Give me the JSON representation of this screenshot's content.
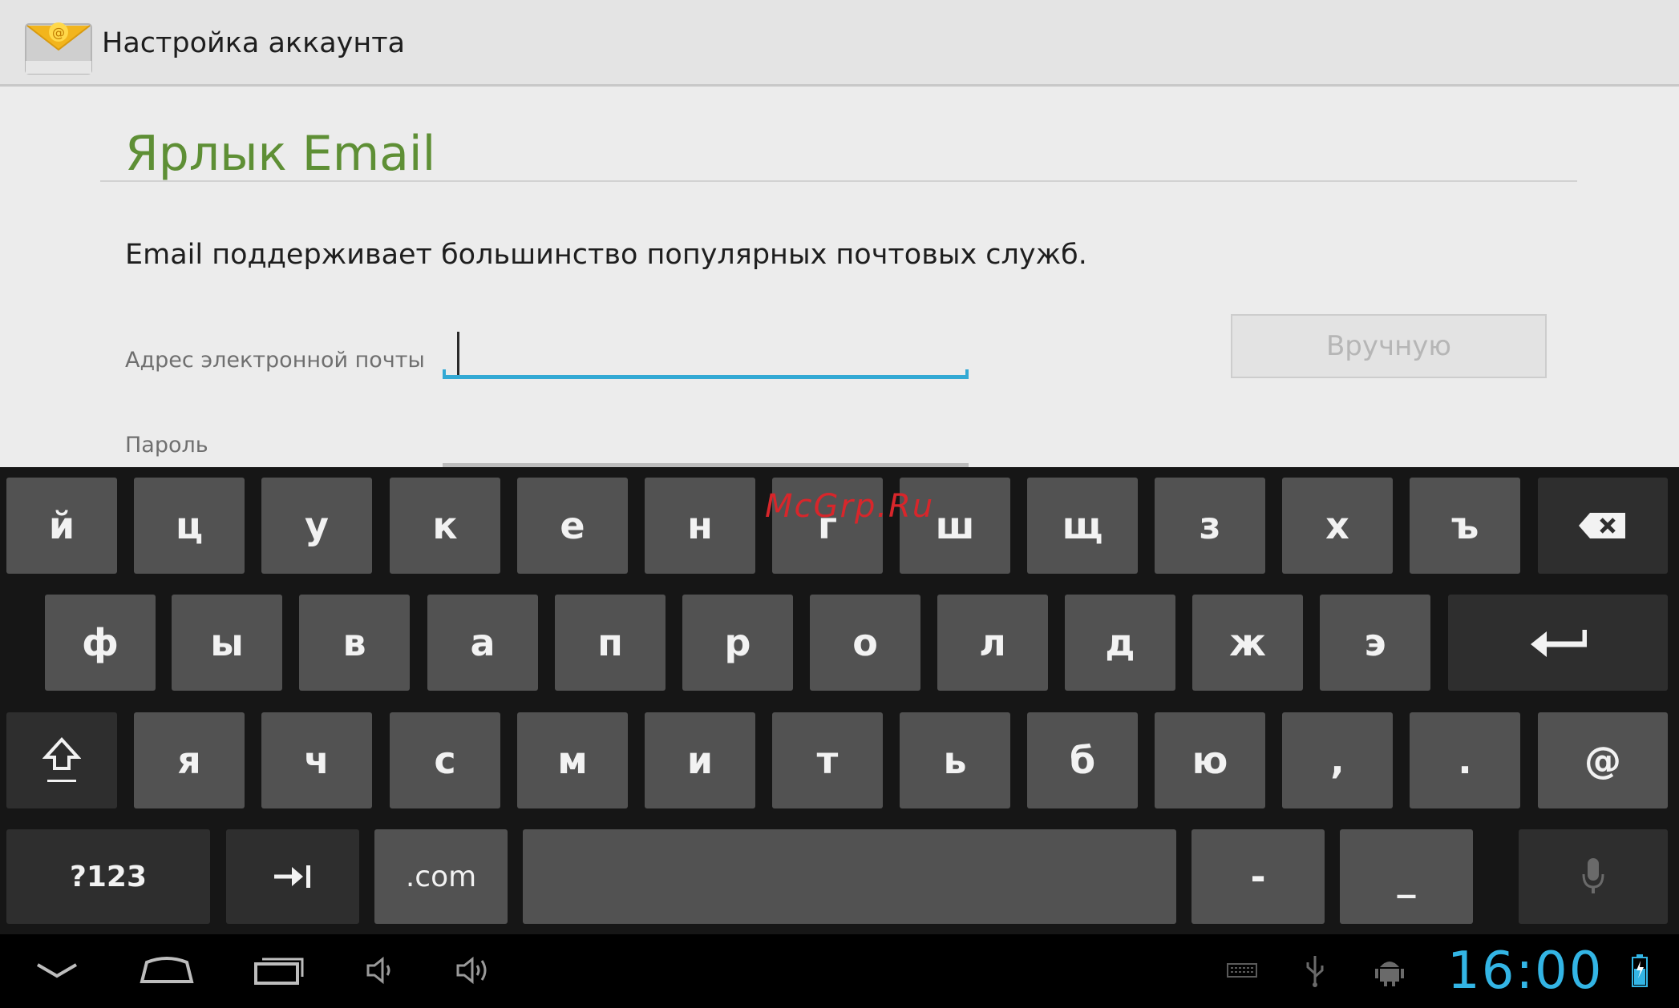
{
  "action_bar": {
    "title": "Настройка аккаунта",
    "app_icon": "email-envelope-icon"
  },
  "content": {
    "section_title": "Ярлык Email",
    "description": "Email поддерживает большинство популярных почтовых служб.",
    "email_label": "Адрес электронной почты",
    "email_value": "",
    "password_label": "Пароль",
    "manual_button": "Вручную"
  },
  "keyboard": {
    "row1": [
      "й",
      "ц",
      "у",
      "к",
      "е",
      "н",
      "г",
      "ш",
      "щ",
      "з",
      "х",
      "ъ"
    ],
    "row2": [
      "ф",
      "ы",
      "в",
      "а",
      "п",
      "р",
      "о",
      "л",
      "д",
      "ж",
      "э"
    ],
    "row3": [
      "я",
      "ч",
      "с",
      "м",
      "и",
      "т",
      "ь",
      "б",
      "ю",
      ",",
      ".",
      "@"
    ],
    "bottom": {
      "symbols": "?123",
      "dotcom": ".com",
      "dash": "-",
      "underscore": "_"
    },
    "special_icons": [
      "backspace-icon",
      "enter-icon",
      "shift-icon",
      "tab-icon",
      "microphone-icon"
    ],
    "watermark": "McGrp.Ru"
  },
  "navbar": {
    "icons": [
      "hide-keyboard-icon",
      "home-icon",
      "recent-apps-icon",
      "volume-down-icon",
      "volume-up-icon",
      "keyboard-icon",
      "usb-icon",
      "android-debug-icon",
      "battery-icon"
    ],
    "clock": "16:00"
  },
  "colors": {
    "accent": "#33b5e5",
    "title_green": "#5e8f35",
    "key": "#525252",
    "keyboard_bg": "#161616"
  }
}
